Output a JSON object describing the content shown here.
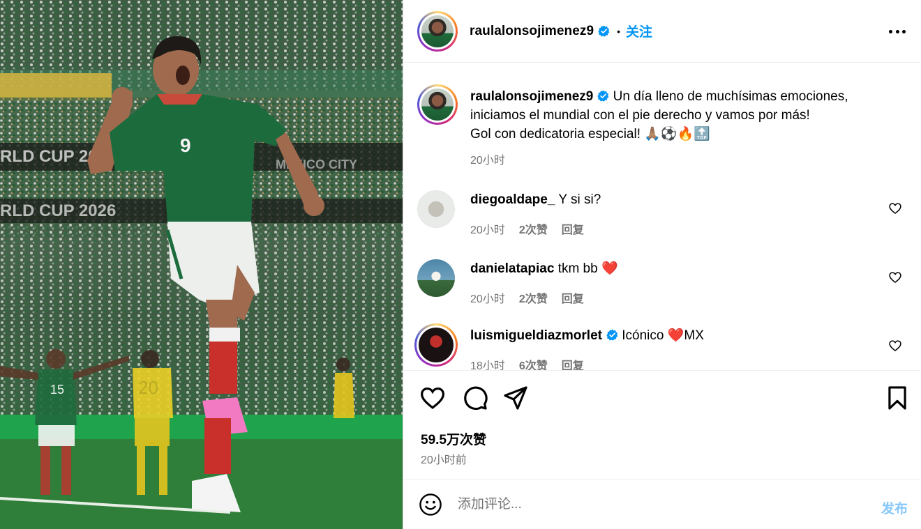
{
  "post": {
    "author": "raulalonsojimenez9",
    "follow_label": "关注",
    "dot": "•",
    "caption_line1": "Un día lleno de muchísimas emociones,",
    "caption_line2": "iniciamos el mundial con el pie derecho y vamos por más!",
    "caption_line3": "Gol con dedicatoria especial!",
    "caption_emojis": "🙏🏽⚽️🔥🔝",
    "caption_time": "20小时",
    "likes": "59.5万次赞",
    "posted_time": "20小时前"
  },
  "photo": {
    "jersey_number": "9",
    "banner_text_top": "RLD CUP 2026",
    "banner_text_bottom": "RLD CUP 2026",
    "banner_city": "MEXICO CITY",
    "player_left_number": "15",
    "player_right_number": "20"
  },
  "comments": [
    {
      "user": "diegoaldape_",
      "text": "Y si si?",
      "time": "20小时",
      "likes": "2次赞",
      "reply": "回复",
      "verified": false
    },
    {
      "user": "danielatapiac",
      "text": "tkm bb ❤️",
      "time": "20小时",
      "likes": "2次赞",
      "reply": "回复",
      "verified": false
    },
    {
      "user": "luismigueldiazmorlet",
      "text": "Icónico ❤️MX",
      "time": "18小时",
      "likes": "6次赞",
      "reply": "回复",
      "verified": true
    }
  ],
  "composer": {
    "placeholder": "添加评论...",
    "post_label": "发布"
  },
  "icons": [
    "verified-icon",
    "more-icon",
    "heart-icon",
    "comment-icon",
    "share-icon",
    "bookmark-icon",
    "emoji-icon"
  ],
  "colors": {
    "accent": "#0095f6",
    "post_disabled": "#86c8f9",
    "muted": "#737373",
    "verified": "#0095f6"
  }
}
